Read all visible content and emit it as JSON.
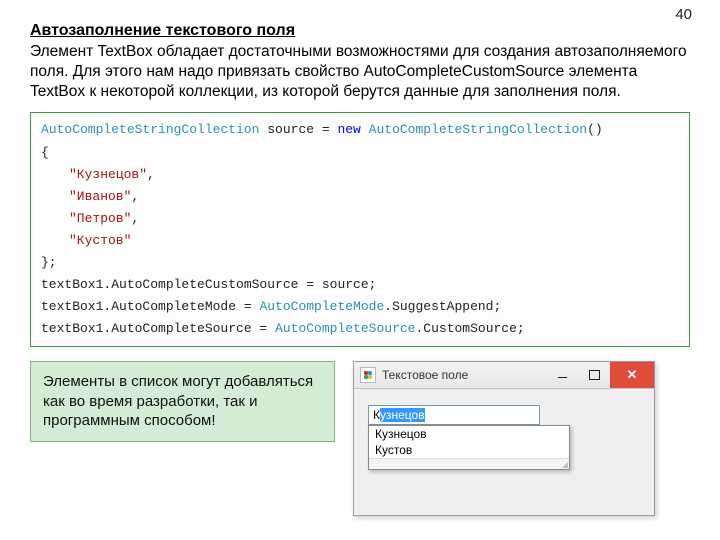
{
  "page_number": "40",
  "title": "Автозаполнение текстового поля",
  "body": "Элемент TextBox обладает достаточными возможностями для создания автозаполняемого поля. Для этого нам надо привязать свойство AutoCompleteCustomSource элемента TextBox к некоторой коллекции, из которой берутся данные для заполнения поля.",
  "code": {
    "l1_type1": "AutoCompleteStringCollection",
    "l1_var": " source = ",
    "l1_kw": "new",
    "l1_sp": " ",
    "l1_type2": "AutoCompleteStringCollection",
    "l1_end": "()",
    "l2": "{",
    "s1": "\"Кузнецов\"",
    "s2": "\"Иванов\"",
    "s3": "\"Петров\"",
    "s4": "\"Кустов\"",
    "comma": ",",
    "l3": "};",
    "l4a": "textBox1.AutoCompleteCustomSource = source;",
    "l5_pre": "textBox1.AutoCompleteMode = ",
    "l5_type": "AutoCompleteMode",
    "l5_post": ".SuggestAppend;",
    "l6_pre": "textBox1.AutoCompleteSource = ",
    "l6_type": "AutoCompleteSource",
    "l6_post": ".CustomSource;"
  },
  "note": "Элементы в список могут добавляться как во время разработки, так и программным способом!",
  "window": {
    "title": "Текстовое поле",
    "close_glyph": "✕",
    "typed_first": "К",
    "typed_sel": "узнецов",
    "suggest1": "Кузнецов",
    "suggest2": "Кустов"
  }
}
